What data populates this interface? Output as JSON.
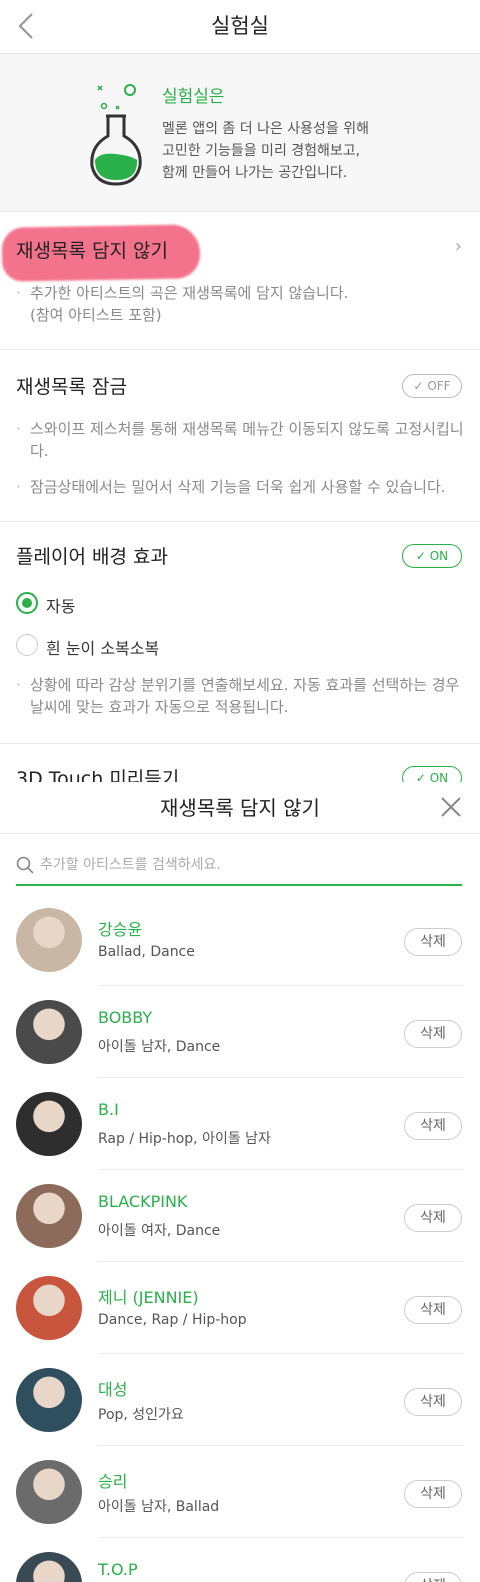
{
  "topbar": {
    "title": "실험실",
    "back_icon": "chevron-left-icon"
  },
  "intro": {
    "title": "실험실은",
    "desc": "멜론 앱의 좀 더 나은 사용성을 위해\n고민한 기능들을 미리 경험해보고,\n함께 만들어 나가는 공간입니다.",
    "icon": "flask-icon",
    "accent": "#2ab04a"
  },
  "sections": {
    "exclude": {
      "title": "재생목록 담지 않기",
      "desc": "추가한 아티스트의 곡은 재생목록에 담지 않습니다.\n(참여 아티스트 포함)",
      "highlight_color": "#f25b79"
    },
    "lock": {
      "title": "재생목록 잠금",
      "toggle": "OFF",
      "desc1": "스와이프 제스처를 통해 재생목록 메뉴간 이동되지 않도록 고정시킵니다.",
      "desc2": "잠금상태에서는 밀어서 삭제 기능을 더욱 쉽게 사용할 수 있습니다."
    },
    "background": {
      "title": "플레이어 배경 효과",
      "toggle": "ON",
      "option_auto": "자동",
      "option_snow": "흰 눈이 소복소복",
      "desc": "상황에 따라 감상 분위기를 연출해보세요. 자동 효과를 선택하는 경우 날씨에 맞는 효과가 자동으로 적용됩니다."
    },
    "touch": {
      "title": "3D Touch 미리듣기",
      "toggle": "ON"
    }
  },
  "sheet": {
    "title": "재생목록 담지 않기",
    "search_placeholder": "추가할 아티스트를 검색하세요.",
    "delete_label": "삭제",
    "artists": [
      {
        "name": "강승윤",
        "genre": "Ballad, Dance",
        "avatar_color": "#c9b7a6"
      },
      {
        "name": "BOBBY",
        "genre": "아이돌 남자, Dance",
        "avatar_color": "#4a4a4a"
      },
      {
        "name": "B.I",
        "genre": "Rap / Hip-hop, 아이돌 남자",
        "avatar_color": "#2e2e2e"
      },
      {
        "name": "BLACKPINK",
        "genre": "아이돌 여자, Dance",
        "avatar_color": "#8c6b5b"
      },
      {
        "name": "제니 (JENNIE)",
        "genre": "Dance, Rap / Hip-hop",
        "avatar_color": "#c8553d"
      },
      {
        "name": "대성",
        "genre": "Pop, 성인가요",
        "avatar_color": "#2f4f5f"
      },
      {
        "name": "승리",
        "genre": "아이돌 남자, Ballad",
        "avatar_color": "#6b6b6b"
      },
      {
        "name": "T.O.P",
        "genre": "",
        "avatar_color": "#3a4a55"
      }
    ]
  }
}
